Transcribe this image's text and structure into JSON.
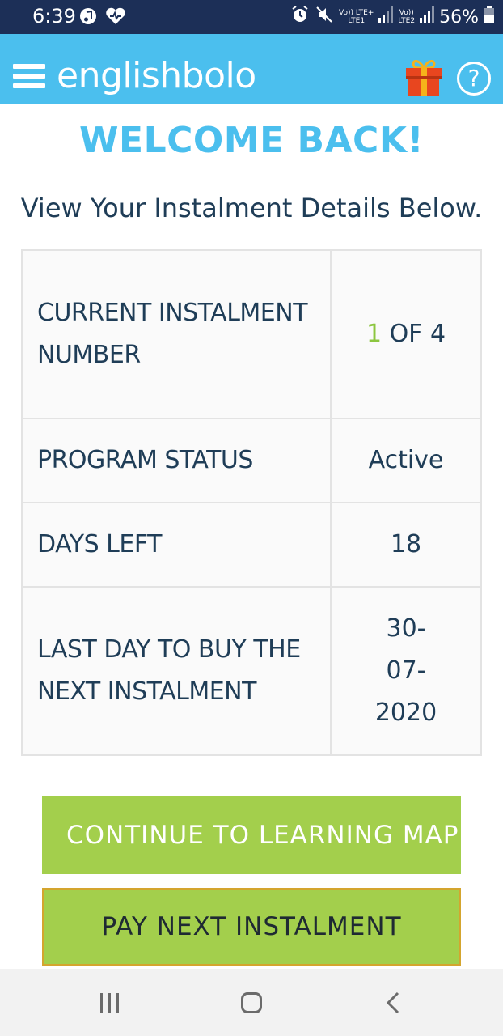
{
  "status_bar": {
    "time": "6:39",
    "network1": "Vo)) LTE+",
    "network1_sub": "LTE1",
    "network2": "Vo))",
    "network2_sub": "LTE2",
    "battery": "56%"
  },
  "header": {
    "brand": "englishbolo",
    "icons": [
      "menu-icon",
      "gift-icon",
      "help-icon"
    ],
    "help_glyph": "?"
  },
  "main": {
    "welcome": "WELCOME BACK!",
    "subtitle": "View Your Instalment Details Below.",
    "rows": [
      {
        "label": "CURRENT INSTALMENT NUMBER",
        "value_current": "1",
        "value_rest": " OF 4"
      },
      {
        "label": "PROGRAM STATUS",
        "value": "Active"
      },
      {
        "label": "DAYS LEFT",
        "value": "18"
      },
      {
        "label": "LAST DAY TO BUY THE NEXT INSTALMENT",
        "value": "30-07-2020"
      }
    ]
  },
  "buttons": {
    "continue": "CONTINUE TO LEARNING MAP",
    "pay": "PAY NEXT INSTALMENT"
  },
  "colors": {
    "status_bar": "#1c2f57",
    "header": "#4bbfee",
    "button": "#a3cf4c",
    "accent_green": "#8cc63f",
    "accent_red": "#c8323e",
    "text_dark": "#1f3d57"
  }
}
